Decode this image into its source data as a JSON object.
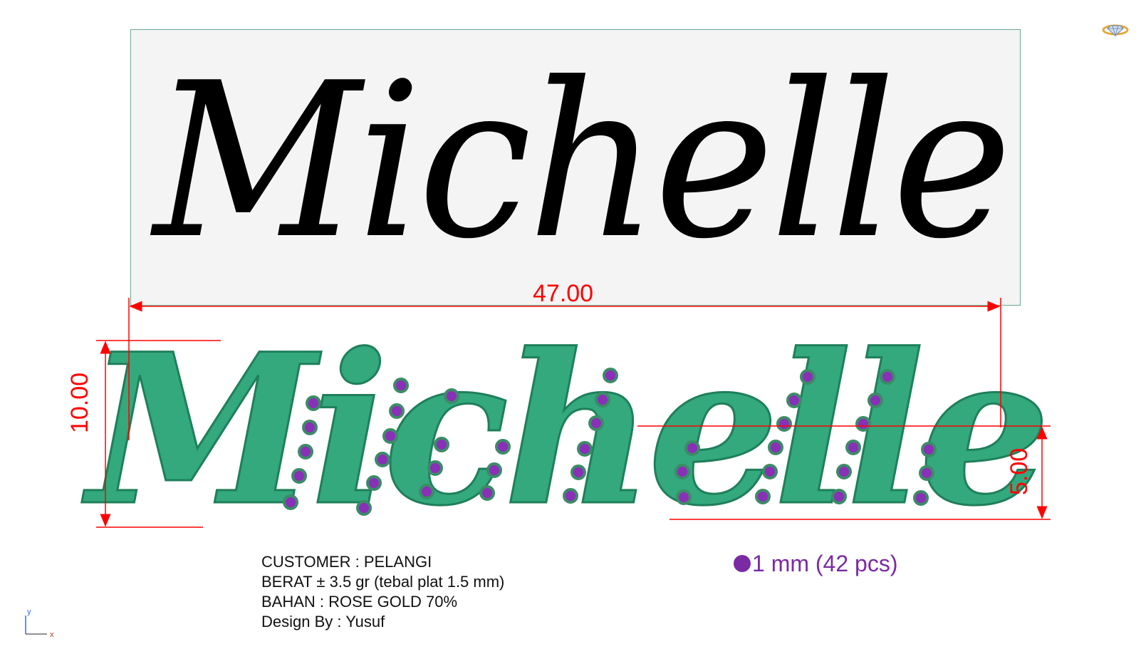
{
  "preview": {
    "text": "Michelle",
    "color": "#000000"
  },
  "model": {
    "text": "Michelle",
    "metal_color": "#33a97d",
    "gem_color": "#7a2aa3"
  },
  "dimensions": {
    "width": "47.00",
    "height": "10.00",
    "x_height": "5.00",
    "color": "#ff0000"
  },
  "specs": {
    "customer": "CUSTOMER : PELANGI",
    "weight": "BERAT ± 3.5 gr (tebal plat 1.5 mm)",
    "material": "BAHAN : ROSE GOLD 70%",
    "designer": "Design By : Yusuf"
  },
  "gem_legend": {
    "text": "1 mm (42 pcs)"
  },
  "axis": {
    "y_label": "y",
    "x_label": "x"
  },
  "logo": {
    "icon": "diamond-ring-icon"
  }
}
